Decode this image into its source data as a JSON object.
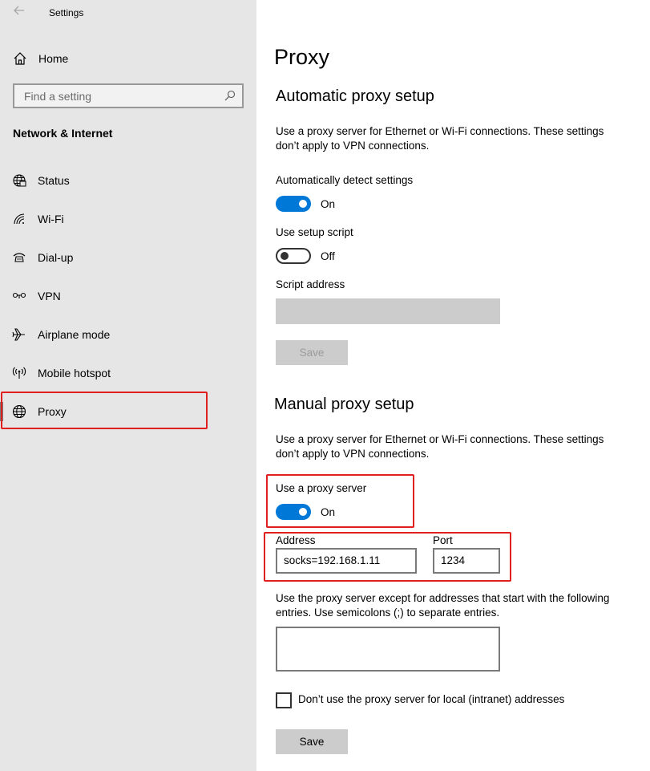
{
  "window": {
    "title": "Settings"
  },
  "sidebar": {
    "home_label": "Home",
    "search_placeholder": "Find a setting",
    "section_heading": "Network & Internet",
    "items": [
      {
        "label": "Status",
        "icon": "status-globe-icon"
      },
      {
        "label": "Wi-Fi",
        "icon": "wifi-icon"
      },
      {
        "label": "Dial-up",
        "icon": "dialup-icon"
      },
      {
        "label": "VPN",
        "icon": "vpn-icon"
      },
      {
        "label": "Airplane mode",
        "icon": "airplane-icon"
      },
      {
        "label": "Mobile hotspot",
        "icon": "hotspot-icon"
      },
      {
        "label": "Proxy",
        "icon": "globe-icon",
        "active": true
      }
    ]
  },
  "main": {
    "page_title": "Proxy",
    "automatic": {
      "heading": "Automatic proxy setup",
      "description": "Use a proxy server for Ethernet or Wi-Fi connections. These settings don’t apply to VPN connections.",
      "auto_detect_label": "Automatically detect settings",
      "auto_detect_state": "On",
      "setup_script_label": "Use setup script",
      "setup_script_state": "Off",
      "script_address_label": "Script address",
      "save_label": "Save"
    },
    "manual": {
      "heading": "Manual proxy setup",
      "description": "Use a proxy server for Ethernet or Wi-Fi connections. These settings don’t apply to VPN connections.",
      "use_proxy_label": "Use a proxy server",
      "use_proxy_state": "On",
      "address_label": "Address",
      "address_value": "socks=192.168.1.11",
      "port_label": "Port",
      "port_value": "1234",
      "exceptions_description": "Use the proxy server except for addresses that start with the following entries. Use semicolons (;) to separate entries.",
      "exceptions_value": "",
      "local_bypass_label": "Don’t use the proxy server for local (intranet) addresses",
      "save_label": "Save"
    }
  },
  "colors": {
    "accent": "#0078d7",
    "highlight": "#e0201f",
    "sidebar_bg": "#e6e6e6"
  }
}
